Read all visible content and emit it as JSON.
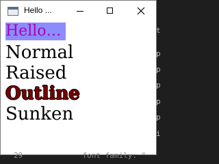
{
  "window": {
    "title": "Hello ...",
    "controls": {
      "minimize": "minimize",
      "maximize": "maximize",
      "close": "close"
    }
  },
  "labels": {
    "hello": "Hello…",
    "normal": "Normal",
    "raised": "Raised",
    "outline": "Outline",
    "sunken": "Sunken"
  },
  "background": {
    "line_number": "29",
    "footer_text": "font family: \""
  },
  "colors": {
    "hello_background": "#8c8cff",
    "hello_text": "#b000b0",
    "outline_text": "#7a0000"
  },
  "icons": {
    "app": "window-icon",
    "minimize": "minimize-icon",
    "maximize": "maximize-icon",
    "close": "close-icon"
  }
}
